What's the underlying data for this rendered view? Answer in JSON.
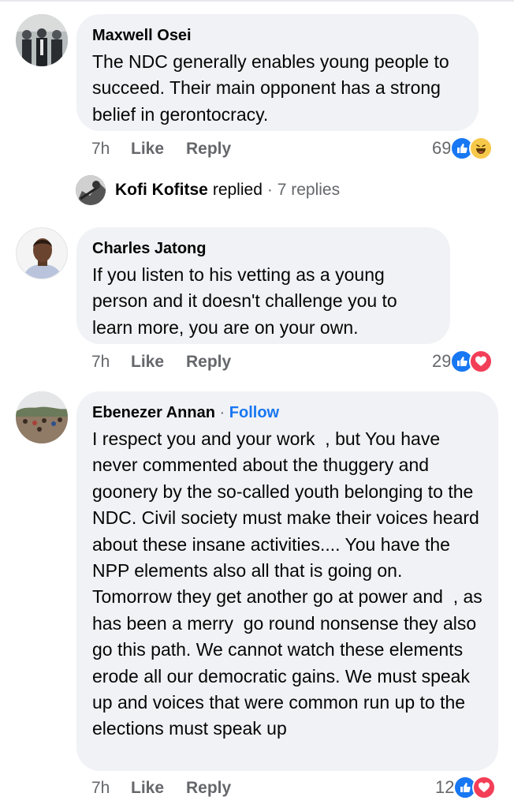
{
  "comments": [
    {
      "author": "Maxwell Osei",
      "text": "The NDC generally enables young people to succeed. Their main opponent has a strong belief in gerontocracy.",
      "time": "7h",
      "like_label": "Like",
      "reply_label": "Reply",
      "reaction_count": "69",
      "reactions": [
        "like-icon",
        "haha-icon"
      ]
    },
    {
      "author": "Charles Jatong",
      "text": "If you listen to his vetting as a young person and it doesn't challenge you to learn more, you are on your own.",
      "time": "7h",
      "like_label": "Like",
      "reply_label": "Reply",
      "reaction_count": "29",
      "reactions": [
        "like-icon",
        "love-icon"
      ]
    },
    {
      "author": "Ebenezer Annan",
      "separator": "·",
      "follow_label": "Follow",
      "text": "I respect you and your work  , but You have never commented about the thuggery and goonery by the so-called youth belonging to the NDC. Civil society must make their voices heard about these insane activities.... You have the NPP elements also all that is going on. Tomorrow they get another go at power and  , as has been a merry  go round nonsense they also  go this path. We cannot watch these elements erode all our democratic gains. We must speak up and voices that were common run up to the elections must speak up",
      "time": "7h",
      "like_label": "Like",
      "reply_label": "Reply",
      "reaction_count": "12",
      "reactions": [
        "like-icon",
        "love-icon"
      ]
    }
  ],
  "reply_summary": {
    "name": "Kofi Kofitse",
    "action": "replied",
    "count_text": "· 7 replies"
  }
}
